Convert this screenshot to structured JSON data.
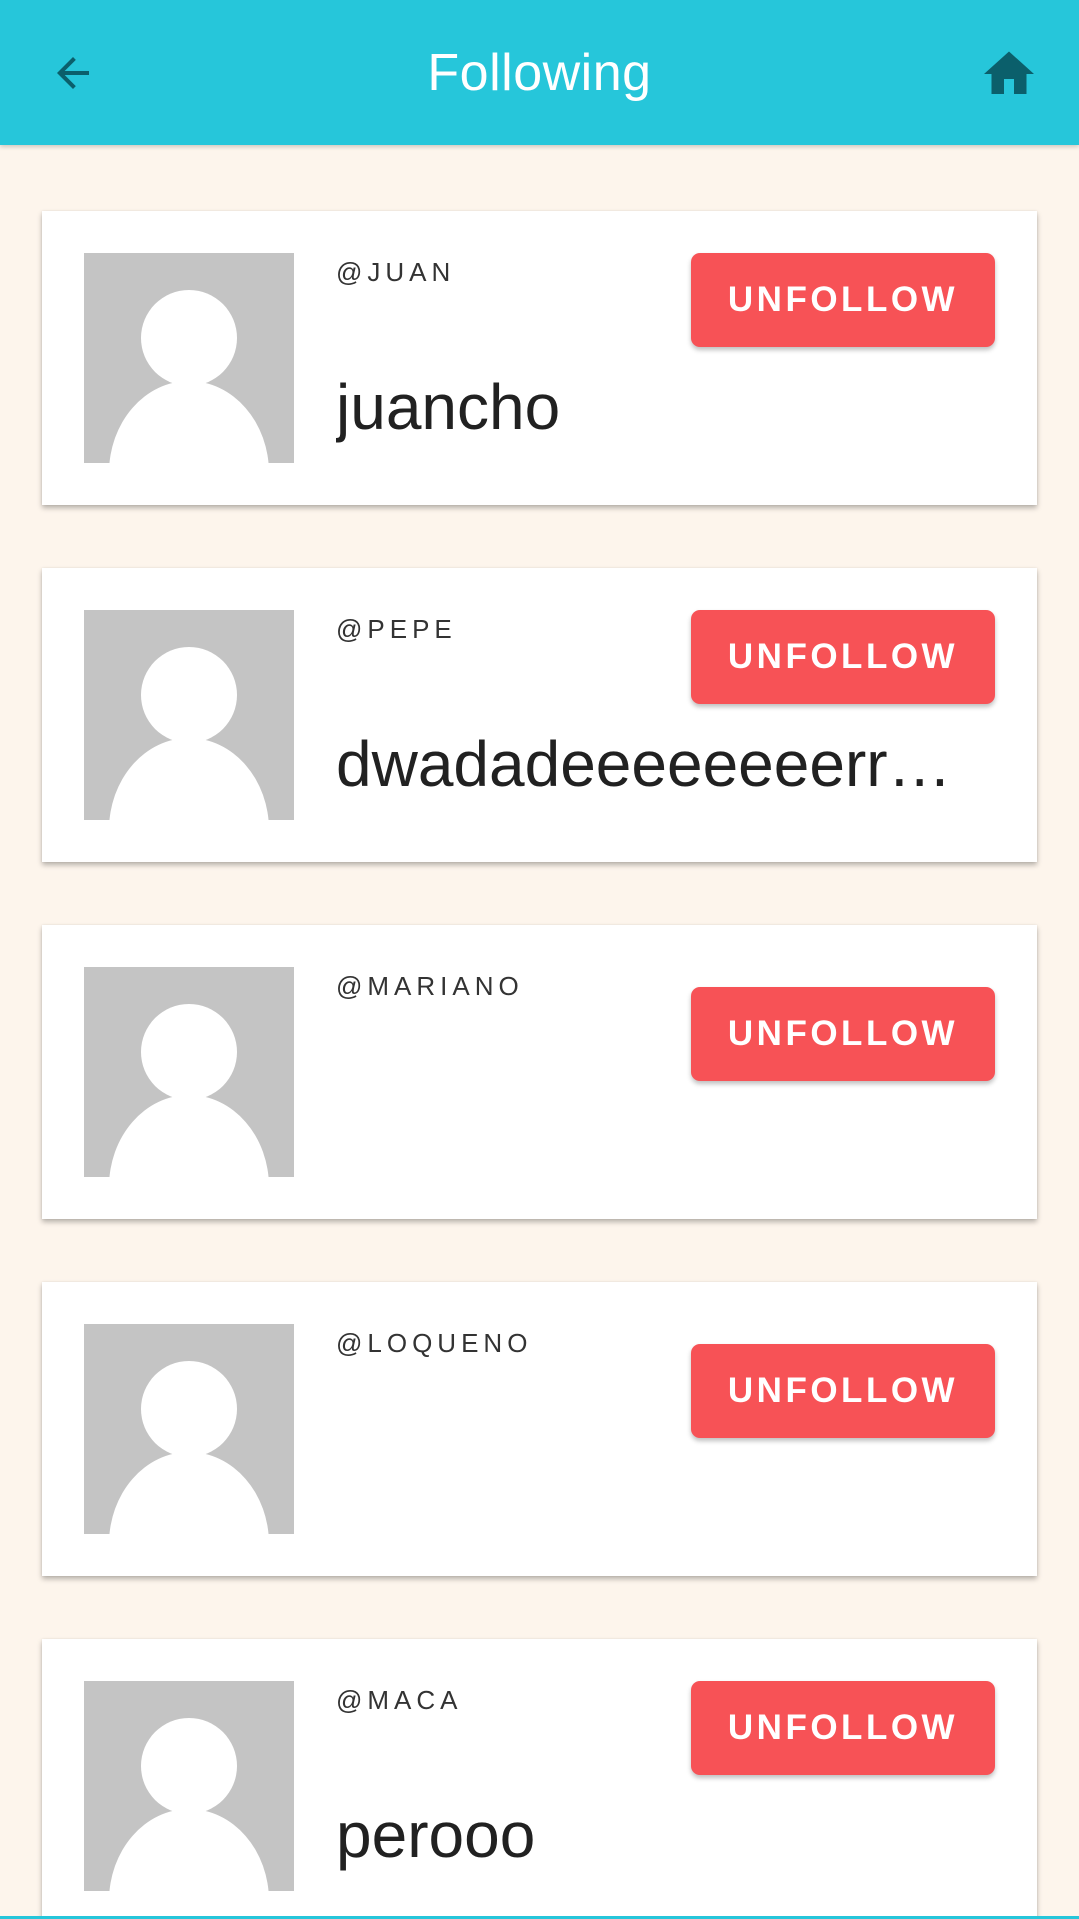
{
  "appbar": {
    "title": "Following",
    "back_icon": "arrow-back-icon",
    "home_icon": "home-icon",
    "background_color": "#26c6da",
    "home_icon_color": "#0b5f6b"
  },
  "colors": {
    "page_background": "#fdf5ec",
    "unfollow_button": "#f75256",
    "avatar_placeholder": "#c4c4c4"
  },
  "users": [
    {
      "handle": "@JUAN",
      "name": "juancho",
      "button_label": "UNFOLLOW"
    },
    {
      "handle": "@PEPE",
      "name": "dwadadeeeeeeeerrer…",
      "button_label": "UNFOLLOW"
    },
    {
      "handle": "@MARIANO",
      "name": "",
      "button_label": "UNFOLLOW"
    },
    {
      "handle": "@LOQUENO",
      "name": "",
      "button_label": "UNFOLLOW"
    },
    {
      "handle": "@MACA",
      "name": "perooo",
      "button_label": "UNFOLLOW"
    }
  ]
}
